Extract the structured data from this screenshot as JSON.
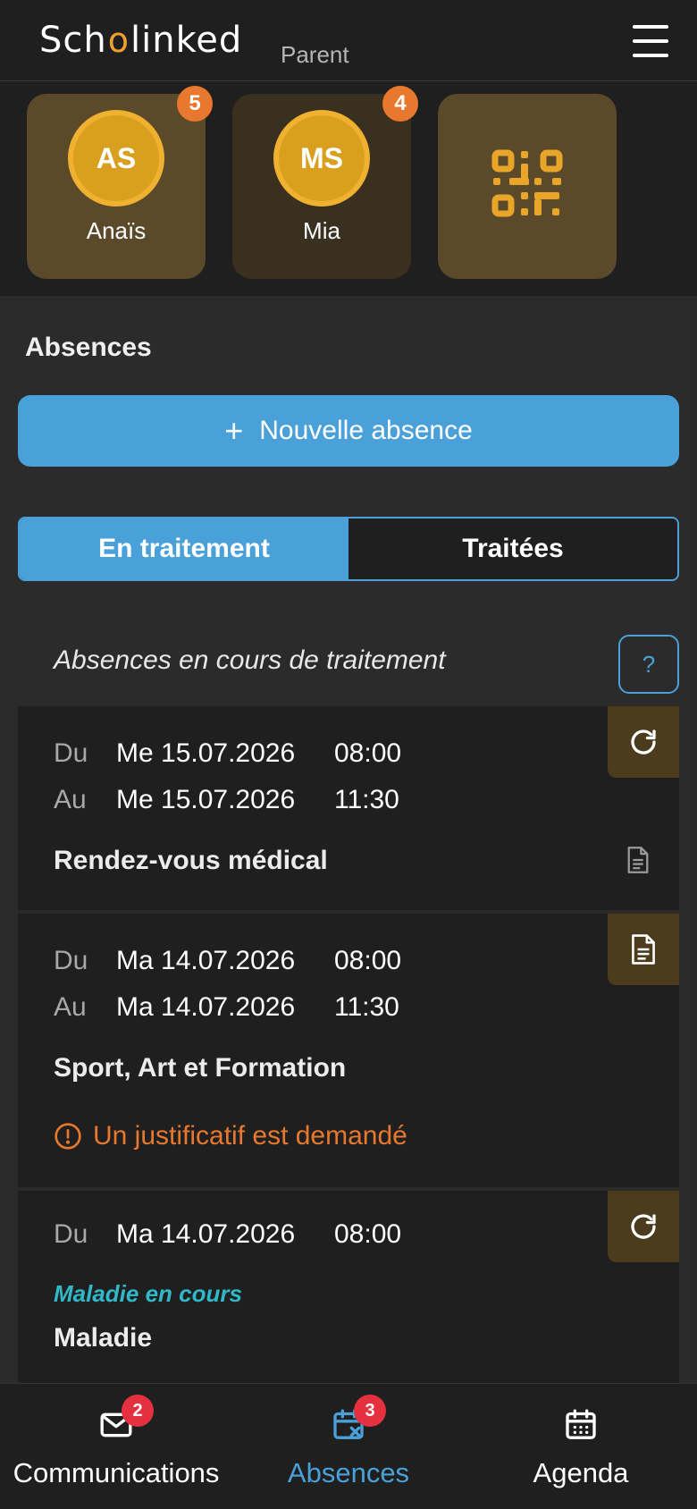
{
  "header": {
    "logo_prefix": "Sch",
    "logo_bubble": "o",
    "logo_suffix": "linked",
    "role": "Parent"
  },
  "profiles": [
    {
      "initials": "AS",
      "name": "Anaïs",
      "badge": "5"
    },
    {
      "initials": "MS",
      "name": "Mia",
      "badge": "4"
    }
  ],
  "section": {
    "title": "Absences",
    "new_button": "Nouvelle absence",
    "tabs": [
      "En traitement",
      "Traitées"
    ],
    "list_heading": "Absences en cours de traitement",
    "help": "?"
  },
  "cards": [
    {
      "from_label": "Du",
      "from_date": "Me 15.07.2026",
      "from_time": "08:00",
      "to_label": "Au",
      "to_date": "Me 15.07.2026",
      "to_time": "11:30",
      "title": "Rendez-vous médical",
      "status_icon": "refresh-icon"
    },
    {
      "from_label": "Du",
      "from_date": "Ma 14.07.2026",
      "from_time": "08:00",
      "to_label": "Au",
      "to_date": "Ma 14.07.2026",
      "to_time": "11:30",
      "title": "Sport, Art et Formation",
      "warning": "Un justificatif est demandé",
      "status_icon": "document-icon"
    },
    {
      "from_label": "Du",
      "from_date": "Ma 14.07.2026",
      "from_time": "08:00",
      "status": "Maladie en cours",
      "title": "Maladie",
      "status_icon": "refresh-icon"
    }
  ],
  "nav": [
    {
      "label": "Communications",
      "badge": "2",
      "icon": "mail-icon"
    },
    {
      "label": "Absences",
      "badge": "3",
      "icon": "calendar-x-icon"
    },
    {
      "label": "Agenda",
      "icon": "calendar-icon"
    }
  ],
  "colors": {
    "accent": "#4aa0d8",
    "brand_orange": "#f0a030",
    "warning": "#e8782e",
    "status_teal": "#30b8c8",
    "badge_red": "#e53040"
  }
}
